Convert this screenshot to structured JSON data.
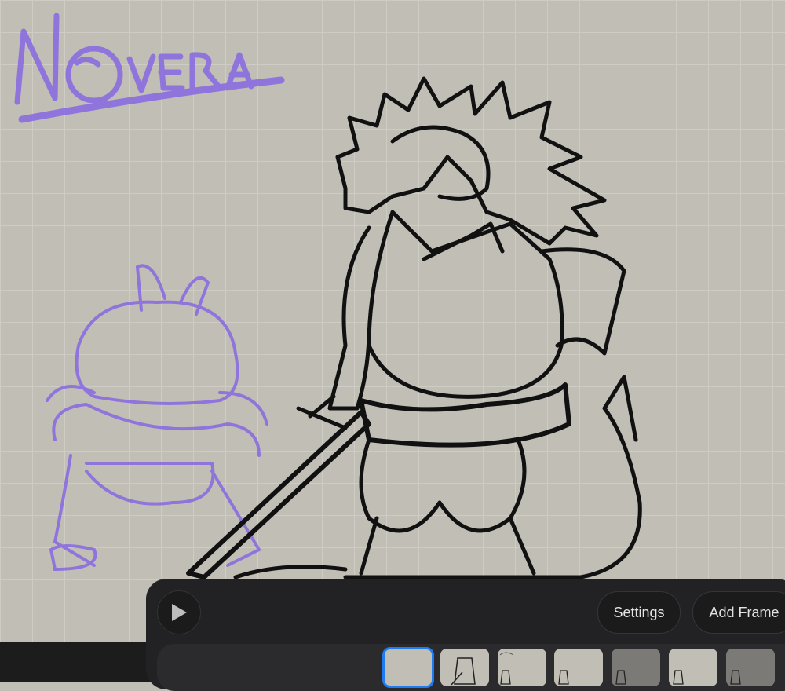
{
  "canvas": {
    "logo_text": "NOVERA",
    "colors": {
      "ink": "#111111",
      "onion_skin": "#8a6ee0",
      "background": "#c1beb6",
      "selected": "#1e7bf2"
    }
  },
  "animation_panel": {
    "play_icon": "play-icon",
    "settings_label": "Settings",
    "add_frame_label": "Add Frame",
    "frames": [
      {
        "state": "selected"
      },
      {
        "state": "normal"
      },
      {
        "state": "normal"
      },
      {
        "state": "normal"
      },
      {
        "state": "dimmed"
      },
      {
        "state": "normal"
      },
      {
        "state": "dimmed"
      }
    ]
  }
}
